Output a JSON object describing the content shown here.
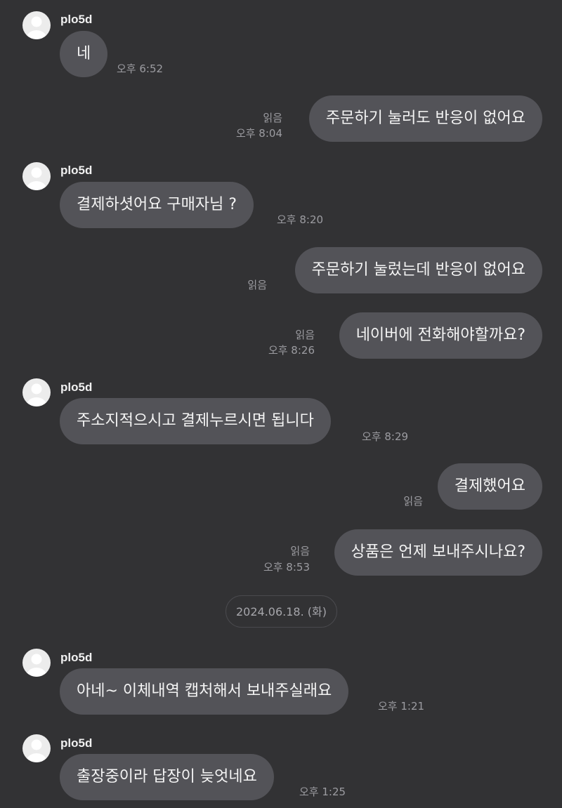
{
  "chat": {
    "sender_name": "plo5d",
    "read_label": "읽음",
    "date_divider": "2024.06.18. (화)",
    "messages": [
      {
        "from": "other",
        "text": "네",
        "time": "오후 6:52"
      },
      {
        "from": "me",
        "text": "주문하기 눌러도 반응이 없어요",
        "read": "읽음",
        "time": "오후 8:04"
      },
      {
        "from": "other",
        "text": "결제하셧어요 구매자님 ?",
        "time": "오후 8:20"
      },
      {
        "from": "me",
        "text": "주문하기 눌렀는데 반응이 없어요",
        "read": "읽음"
      },
      {
        "from": "me",
        "text": "네이버에 전화해야할까요?",
        "read": "읽음",
        "time": "오후 8:26"
      },
      {
        "from": "other",
        "text": "주소지적으시고 결제누르시면 됩니다",
        "time": "오후 8:29"
      },
      {
        "from": "me",
        "text": "결제했어요",
        "read": "읽음"
      },
      {
        "from": "me",
        "text": "상품은 언제 보내주시나요?",
        "read": "읽음",
        "time": "오후 8:53"
      },
      {
        "from": "other",
        "text": "아네~ 이체내역 캡처해서 보내주실래요",
        "time": "오후 1:21"
      },
      {
        "from": "other",
        "text": "출장중이라 답장이 늦엇네요",
        "time": "오후 1:25"
      }
    ]
  }
}
